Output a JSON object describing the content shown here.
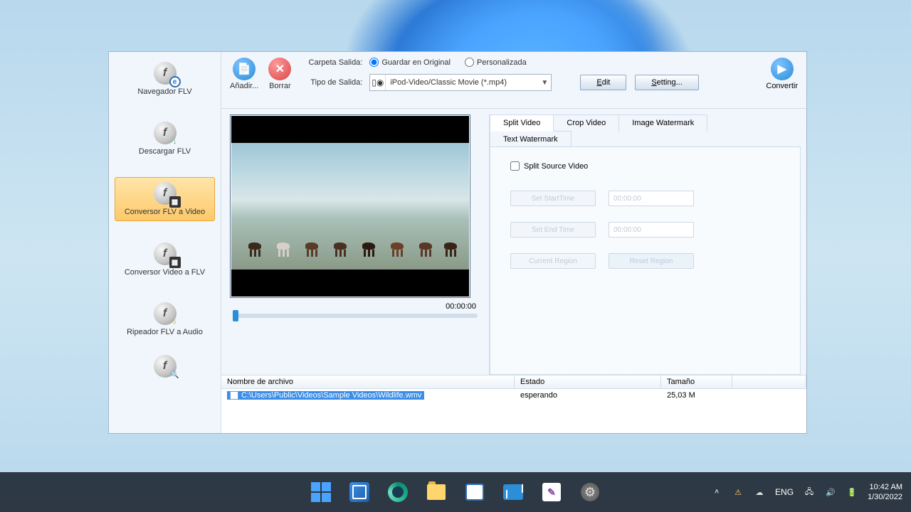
{
  "sidebar": {
    "items": [
      {
        "label": "Navegador FLV"
      },
      {
        "label": "Descargar FLV"
      },
      {
        "label": "Conversor FLV a Video"
      },
      {
        "label": "Conversor Video a FLV"
      },
      {
        "label": "Ripeador FLV a Audio"
      }
    ]
  },
  "toolbar": {
    "add_label": "Añadir...",
    "del_label": "Borrar",
    "convert_label": "Convertir",
    "output_label": "Carpeta Salida:",
    "save_original_label": "Guardar en Original",
    "custom_label": "Personalizada",
    "format_label": "Tipo de Salida:",
    "format_value": "iPod-Video/Classic Movie (*.mp4)",
    "edit_label": "Edit",
    "setting_label": "Setting..."
  },
  "preview": {
    "time": "00:00:00"
  },
  "tabs": {
    "split": "Split Video",
    "crop": "Crop Video",
    "image_wm": "Image Watermark",
    "text_wm": "Text Watermark",
    "split_source_label": "Split Source Video",
    "start_btn": "Set StartTime",
    "end_btn": "Set End Time",
    "current_btn": "Current Region",
    "reset_btn": "Reset Region",
    "start_val": "00:00:00",
    "end_val": "00:00:00"
  },
  "filelist": {
    "col_name": "Nombre de archivo",
    "col_state": "Estado",
    "col_size": "Tamaño",
    "rows": [
      {
        "path": "C:\\Users\\Public\\Videos\\Sample Videos\\Wildlife.wmv",
        "state": "esperando",
        "size": "25,03 M"
      }
    ]
  },
  "tray": {
    "lang": "ENG",
    "time": "10:42 AM",
    "date": "1/30/2022"
  }
}
